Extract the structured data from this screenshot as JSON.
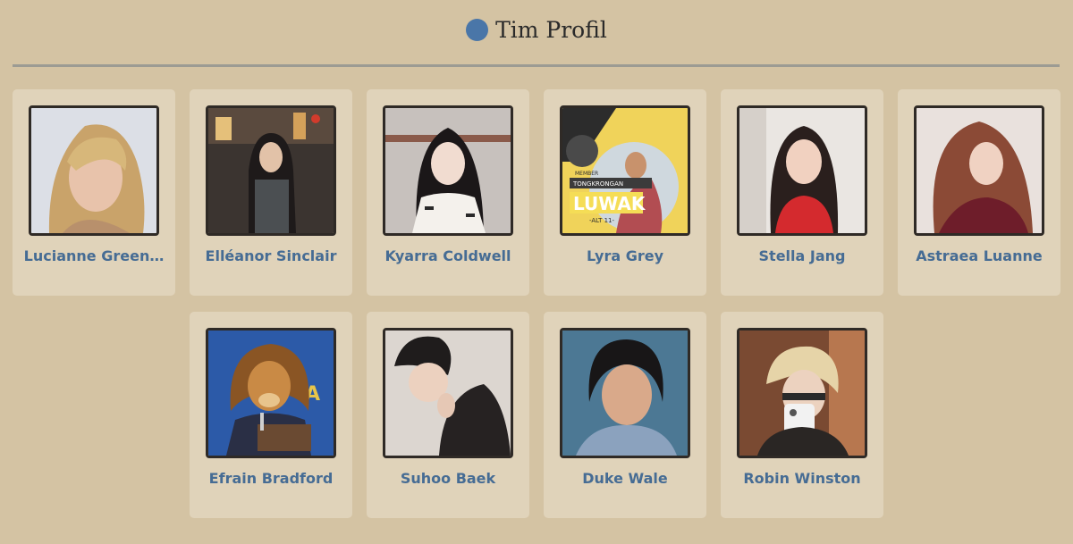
{
  "header": {
    "title": "Tim Profil",
    "accent_color": "#4a76a8"
  },
  "profiles": [
    {
      "name": "Lucianne Greenwood",
      "display_name": "Lucianne Green…",
      "icon": "avatar-photo"
    },
    {
      "name": "Elléanor Sinclair",
      "display_name": "Elléanor Sinclair",
      "icon": "avatar-photo"
    },
    {
      "name": "Kyarra Coldwell",
      "display_name": "Kyarra Coldwell",
      "icon": "avatar-photo"
    },
    {
      "name": "Lyra Grey",
      "display_name": "Lyra Grey",
      "icon": "avatar-photo",
      "photo_text": [
        "MEMBER",
        "TONGKRONGAN",
        "LUWAK",
        "-ALT 11-"
      ]
    },
    {
      "name": "Stella Jang",
      "display_name": "Stella Jang",
      "icon": "avatar-photo"
    },
    {
      "name": "Astraea Luanne",
      "display_name": "Astraea Luanne",
      "icon": "avatar-photo"
    },
    {
      "name": "Efrain Bradford",
      "display_name": "Efrain Bradford",
      "icon": "avatar-photo"
    },
    {
      "name": "Suhoo Baek",
      "display_name": "Suhoo Baek",
      "icon": "avatar-photo"
    },
    {
      "name": "Duke Wale",
      "display_name": "Duke Wale",
      "icon": "avatar-photo"
    },
    {
      "name": "Robin Winston",
      "display_name": "Robin Winston",
      "icon": "avatar-photo"
    }
  ],
  "colors": {
    "background": "#d4c3a3",
    "card": "#e0d3ba",
    "name_text": "#466c94",
    "divider": "#9c9b93"
  }
}
